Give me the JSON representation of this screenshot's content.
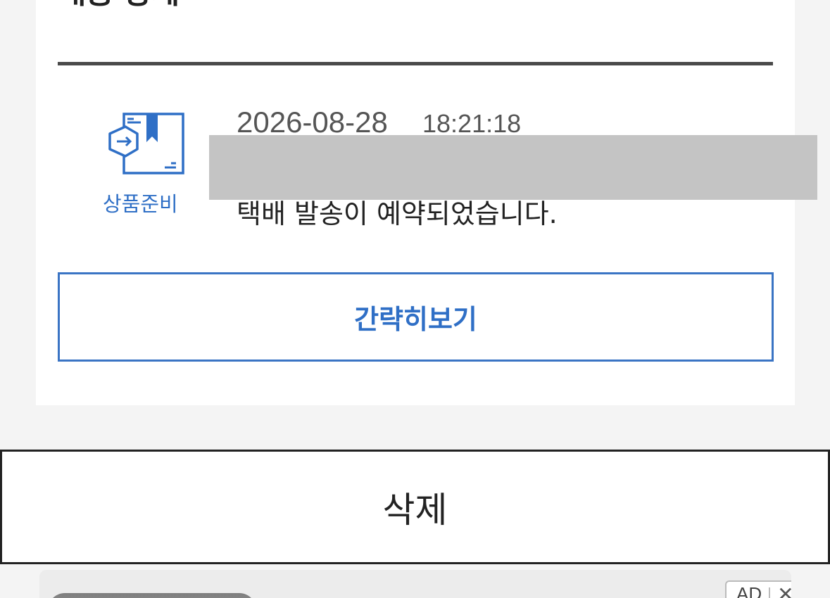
{
  "section": {
    "title": "배송 상세"
  },
  "entry": {
    "status_icon": "package-ship-icon",
    "status_label": "상품준비",
    "date": "2026-08-28",
    "time": "18:21:18",
    "message": "택배 발송이 예약되었습니다."
  },
  "buttons": {
    "collapse_label": "간략히보기",
    "delete_label": "삭제"
  },
  "ad": {
    "badge": "AD",
    "close_icon": "close-icon",
    "close_glyph": "✕"
  },
  "colors": {
    "accent": "#2f6fc6",
    "border_accent": "#3a74c4",
    "page_bg": "#f4f4f4",
    "redaction": "#c4c4c4"
  }
}
